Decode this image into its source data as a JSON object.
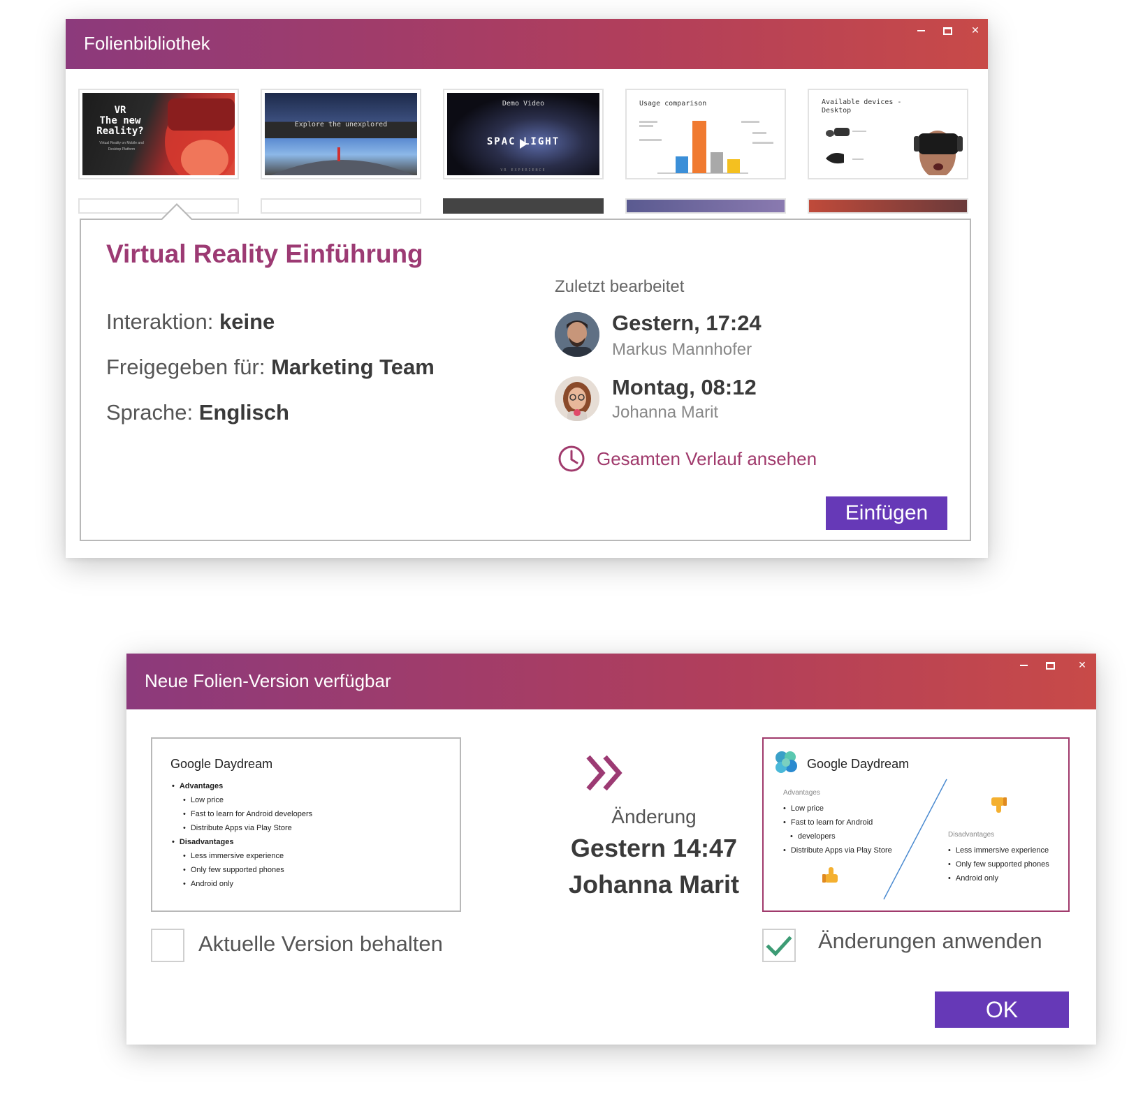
{
  "library_window": {
    "title": "Folienbibliothek",
    "thumbnails": [
      {
        "line1": "VR",
        "line2": "The new",
        "line3": "Reality?",
        "sub1": "Virtual Reality on Mobile and",
        "sub2": "Desktop Platform"
      },
      {
        "caption": "Explore the unexplored"
      },
      {
        "top": "Demo Video",
        "center": "SPAC LIGHT",
        "sub": "VR EXPERIENCE"
      },
      {
        "title": "Usage comparison"
      },
      {
        "title": "Available devices - Desktop"
      }
    ],
    "details": {
      "title": "Virtual Reality Einführung",
      "interaction_label": "Interaktion:",
      "interaction_value": "keine",
      "shared_label": "Freigegeben für:",
      "shared_value": "Marketing Team",
      "language_label": "Sprache:",
      "language_value": "Englisch",
      "last_edited_label": "Zuletzt bearbeitet",
      "edits": [
        {
          "time": "Gestern, 17:24",
          "user": "Markus Mannhofer"
        },
        {
          "time": "Montag, 08:12",
          "user": "Johanna Marit"
        }
      ],
      "history_link": "Gesamten Verlauf ansehen",
      "insert_button": "Einfügen"
    }
  },
  "version_window": {
    "title": "Neue Folien-Version verfügbar",
    "old_slide": {
      "title": "Google Daydream",
      "advantages_label": "Advantages",
      "advantages": [
        "Low price",
        "Fast to learn for Android developers",
        "Distribute Apps via Play Store"
      ],
      "disadvantages_label": "Disadvantages",
      "disadvantages": [
        "Less immersive experience",
        "Only few supported phones",
        "Android only"
      ]
    },
    "new_slide": {
      "title": "Google Daydream",
      "advantages_label": "Advantages",
      "advantages": [
        "Low price",
        "Fast to learn for Android",
        "developers",
        "Distribute Apps via Play Store"
      ],
      "disadvantages_label": "Disadvantages",
      "disadvantages": [
        "Less immersive experience",
        "Only few supported phones",
        "Android only"
      ]
    },
    "change_label": "Änderung",
    "change_time": "Gestern 14:47",
    "change_user": "Johanna Marit",
    "keep_label": "Aktuelle Version behalten",
    "apply_label": "Änderungen anwenden",
    "keep_checked": false,
    "apply_checked": true,
    "ok_button": "OK"
  },
  "colors": {
    "titlebar_start": "#8c3a7c",
    "titlebar_end": "#c84a48",
    "accent": "#9c3a73",
    "button": "#6639b7",
    "check": "#3c9b74"
  }
}
